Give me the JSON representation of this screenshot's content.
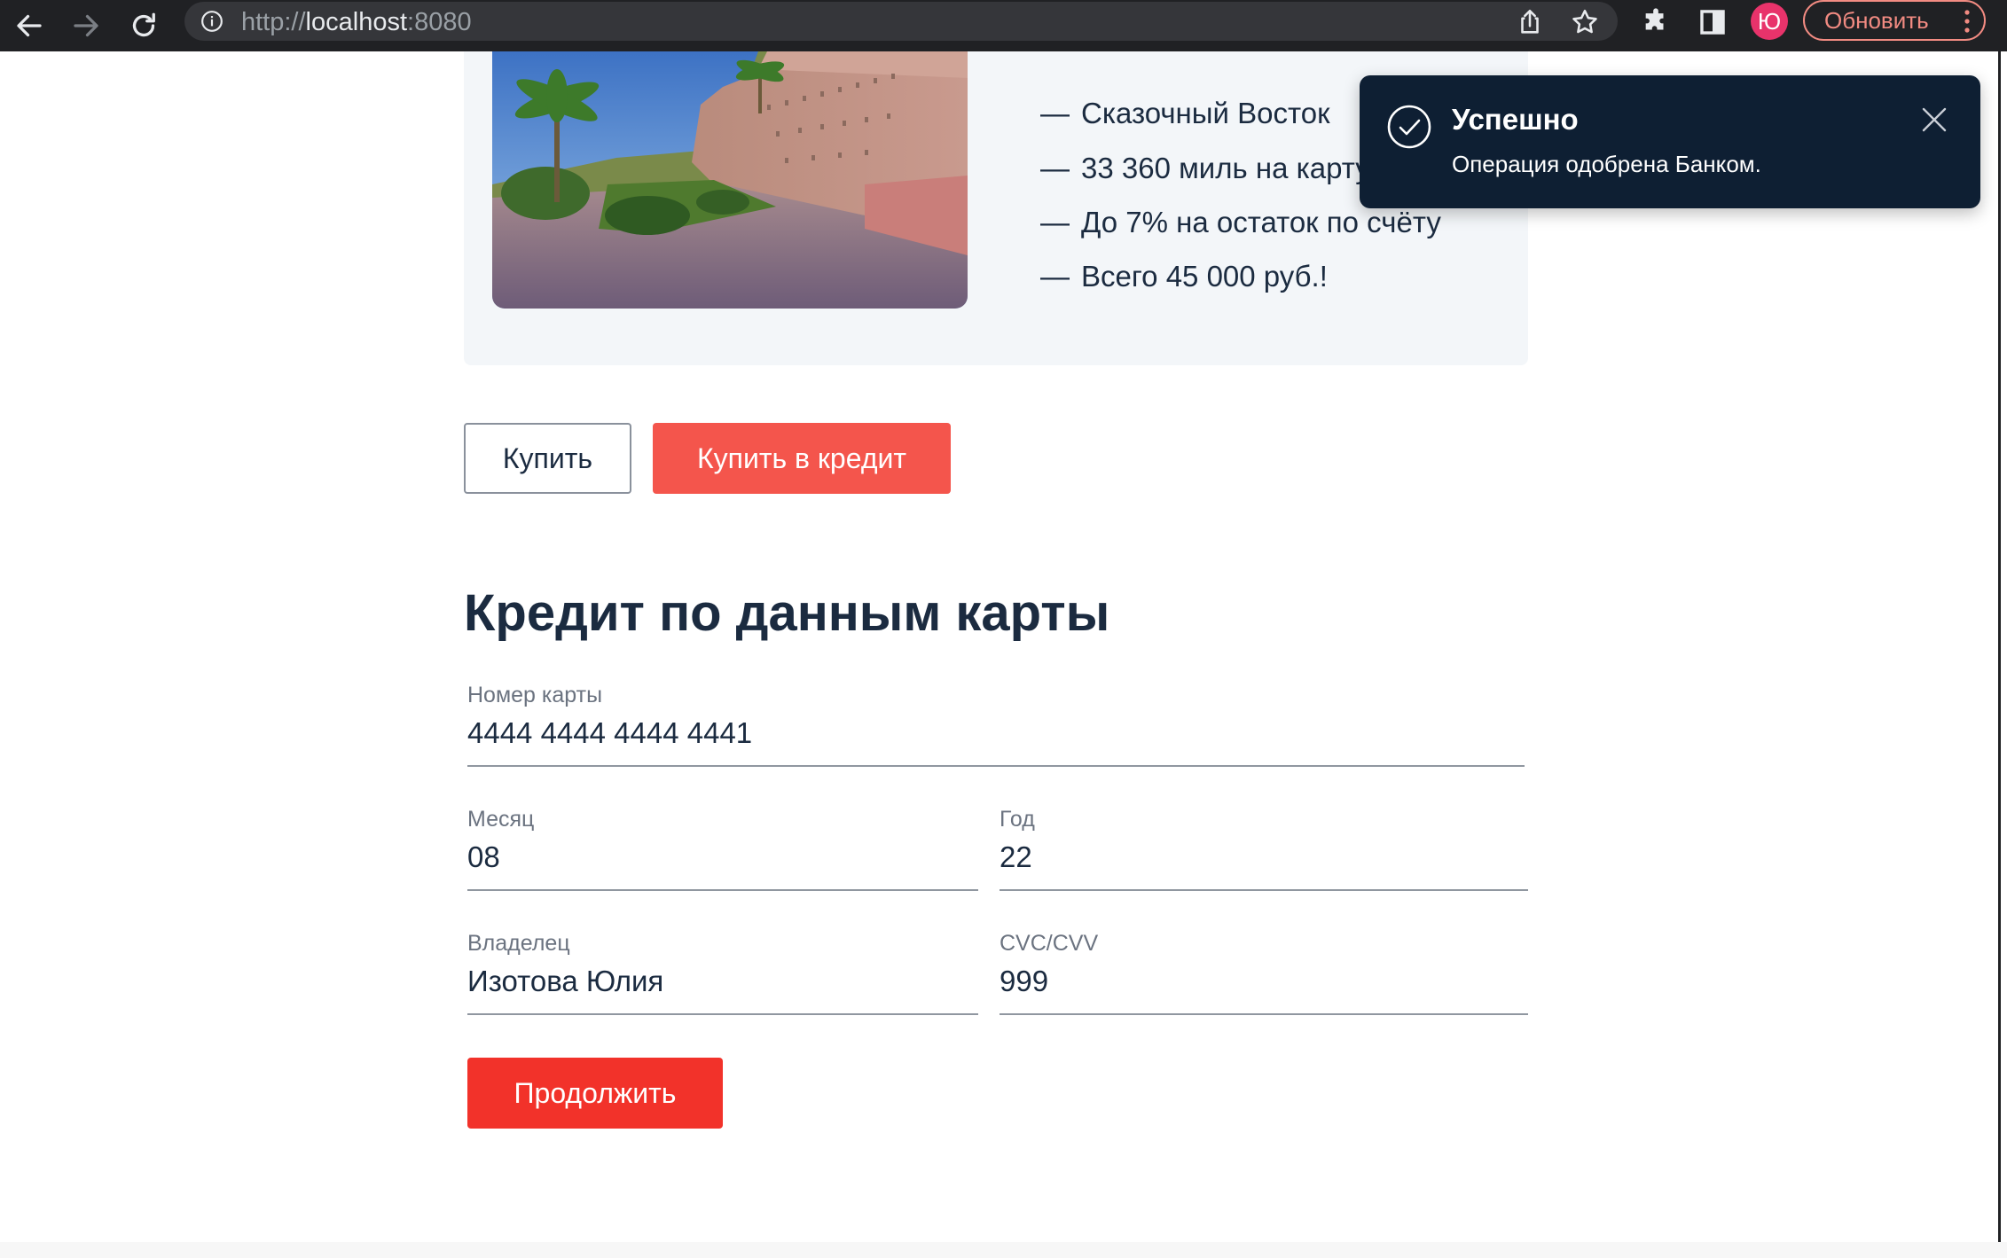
{
  "browser": {
    "url_scheme": "http://",
    "url_host": "localhost",
    "url_port": ":8080",
    "avatar_letter": "Ю",
    "update_label": "Обновить",
    "update_color": "#f28b82"
  },
  "product": {
    "features": [
      "Сказочный Восток",
      "33 360 миль на карту",
      "До 7% на остаток по счёту",
      "Всего 45 000 руб.!"
    ],
    "feature_dash": "—"
  },
  "actions": {
    "buy_label": "Купить",
    "credit_label": "Купить в кредит"
  },
  "form": {
    "title": "Кредит по данным карты",
    "card_number": {
      "label": "Номер карты",
      "value": "4444 4444 4444 4441"
    },
    "month": {
      "label": "Месяц",
      "value": "08"
    },
    "year": {
      "label": "Год",
      "value": "22"
    },
    "owner": {
      "label": "Владелец",
      "value": "Изотова Юлия"
    },
    "cvc": {
      "label": "CVC/CVV",
      "value": "999"
    },
    "continue_label": "Продолжить"
  },
  "notification": {
    "title": "Успешно",
    "message": "Операция одобрена Банком.",
    "background": "#0e1f33"
  },
  "colors": {
    "accent": "#f4554c",
    "accent_strong": "#f2322a",
    "text": "#1b2b40"
  }
}
